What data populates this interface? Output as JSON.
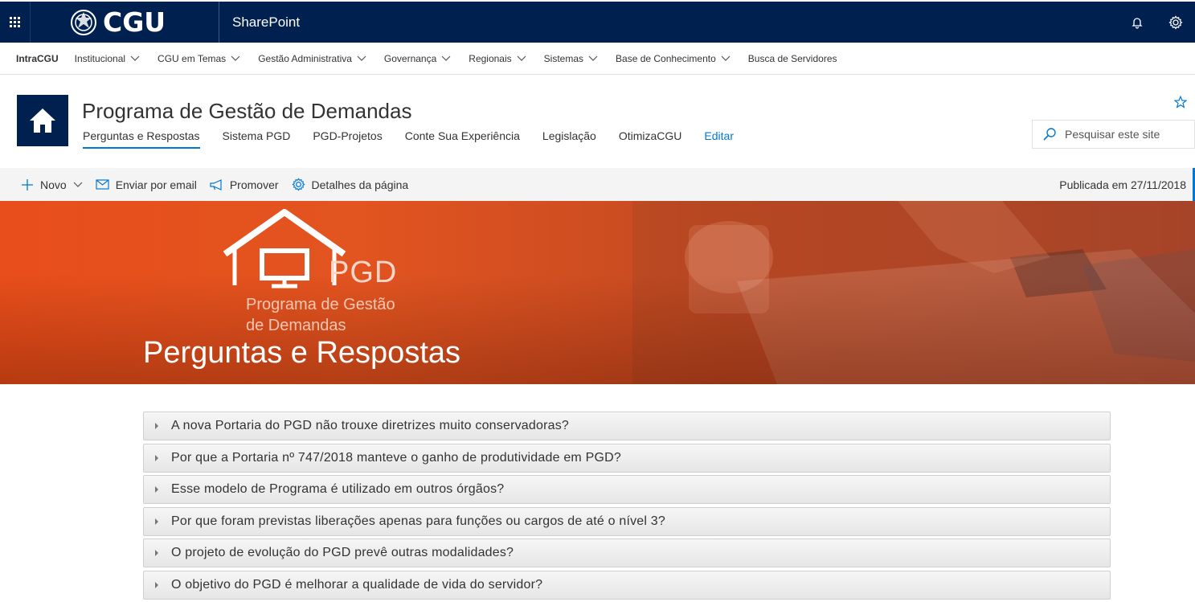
{
  "suitebar": {
    "logo_text": "CGU",
    "app_name": "SharePoint",
    "icons": [
      "waffle-icon",
      "bell-icon",
      "gear-icon"
    ]
  },
  "hubnav": {
    "home": "IntraCGU",
    "items": [
      {
        "label": "Institucional",
        "has_menu": true
      },
      {
        "label": "CGU em Temas",
        "has_menu": true
      },
      {
        "label": "Gestão Administrativa",
        "has_menu": true
      },
      {
        "label": "Governança",
        "has_menu": true
      },
      {
        "label": "Regionais",
        "has_menu": true
      },
      {
        "label": "Sistemas",
        "has_menu": true
      },
      {
        "label": "Base de Conhecimento",
        "has_menu": true
      },
      {
        "label": "Busca de Servidores",
        "has_menu": false
      }
    ]
  },
  "site": {
    "title": "Programa de Gestão de Demandas",
    "nav": [
      "Perguntas e Respostas",
      "Sistema PGD",
      "PGD-Projetos",
      "Conte Sua Experiência",
      "Legislação",
      "OtimizaCGU"
    ],
    "edit_label": "Editar",
    "search_placeholder": "Pesquisar este site"
  },
  "commandbar": {
    "new_label": "Novo",
    "email_label": "Enviar por email",
    "promote_label": "Promover",
    "details_label": "Detalhes da página",
    "status": "Publicada em 27/11/2018"
  },
  "hero": {
    "logo_text": "PGD",
    "logo_sub_line1": "Programa de Gestão",
    "logo_sub_line2": "de Demandas",
    "title": "Perguntas e Respostas"
  },
  "faq": [
    "A nova Portaria do PGD não trouxe diretrizes muito conservadoras?",
    "Por que a Portaria nº 747/2018 manteve o ganho de produtividade em PGD?",
    "Esse modelo de Programa é utilizado em outros órgãos?",
    "Por que foram previstas liberações apenas para funções ou cargos de até o nível 3?",
    "O projeto de evolução do PGD prevê outras modalidades?",
    "O objetivo do PGD é melhorar a qualidade de vida do servidor?"
  ],
  "colors": {
    "suitebar": "#002050",
    "accent": "#0078d4",
    "hero": "#e84e1b"
  }
}
